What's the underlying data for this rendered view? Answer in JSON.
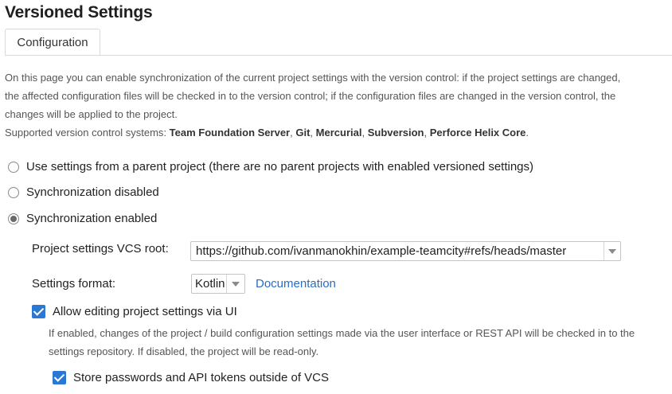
{
  "page": {
    "title": "Versioned Settings"
  },
  "tabs": [
    {
      "label": "Configuration"
    }
  ],
  "description": {
    "line1": "On this page you can enable synchronization of the current project settings with the version control: if the project settings are changed, the affected configuration files will be checked in to the version control; if the configuration files are changed in the version control, the changes will be applied to the project.",
    "supported_prefix": "Supported version control systems: ",
    "systems": [
      "Team Foundation Server",
      "Git",
      "Mercurial",
      "Subversion",
      "Perforce Helix Core"
    ],
    "sep": ", ",
    "end": "."
  },
  "sync_options": [
    {
      "label": "Use settings from a parent project (there are no parent projects with enabled versioned settings)",
      "selected": false
    },
    {
      "label": "Synchronization disabled",
      "selected": false
    },
    {
      "label": "Synchronization enabled",
      "selected": true
    }
  ],
  "vcs_root": {
    "label": "Project settings VCS root:",
    "value": "https://github.com/ivanmanokhin/example-teamcity#refs/heads/master"
  },
  "settings_format": {
    "label": "Settings format:",
    "value": "Kotlin",
    "link": "Documentation"
  },
  "allow_editing": {
    "label": "Allow editing project settings via UI",
    "checked": true,
    "hint": "If enabled, changes of the project / build configuration settings made via the user interface or REST API will be checked in to the settings repository. If disabled, the project will be read-only."
  },
  "store_passwords": {
    "label": "Store passwords and API tokens outside of VCS",
    "checked": true
  }
}
